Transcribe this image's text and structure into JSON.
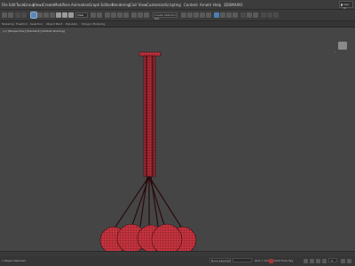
{
  "menubar": {
    "items": [
      "File",
      "Edit",
      "Tools",
      "Group",
      "Views",
      "Create",
      "Modifiers",
      "Animation",
      "Graph Editors",
      "Rendering",
      "Civil View",
      "Customize",
      "Scripting",
      "Content",
      "Arnold",
      "Help",
      "3DSMAXIO"
    ],
    "signin_label": "Sign In"
  },
  "toolbar": {
    "view_dropdown": "View",
    "selection_set": "Create Selection Set"
  },
  "ribbon": {
    "tabs": [
      "Modeling",
      "Freeform",
      "Selection",
      "Object Paint",
      "Populate"
    ],
    "sub_label": "Polygon Modeling"
  },
  "viewport": {
    "label": "[+] [Perspective] [Standard] [Default Shading]",
    "mesh_color": "#c9343f",
    "wire_color": "#3a0f12",
    "background": "#454545"
  },
  "statusbar": {
    "left_text": "1 Object Selected",
    "selection": "None selected",
    "grid": "Grid = 10.0mm",
    "add_time_tag": "Add Time Tag",
    "frame": "0"
  }
}
